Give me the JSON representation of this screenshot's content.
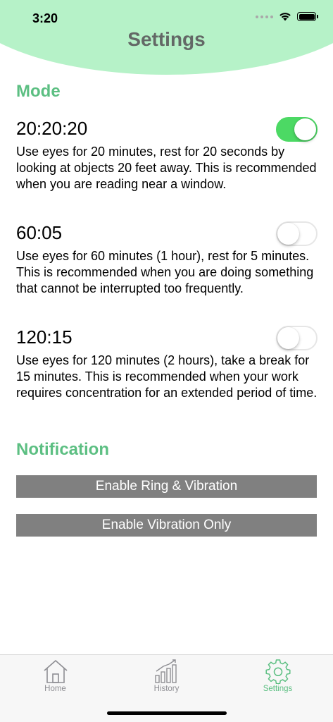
{
  "status_bar": {
    "time": "3:20"
  },
  "header": {
    "title": "Settings"
  },
  "mode_section": {
    "title": "Mode",
    "items": [
      {
        "name": "20:20:20",
        "description": "Use eyes for 20 minutes, rest for 20 seconds by looking at objects 20 feet away. This is recommended when you are reading near a window.",
        "enabled": true
      },
      {
        "name": "60:05",
        "description": "Use eyes for 60 minutes (1 hour), rest for 5 minutes. This is recommended when you are doing something that cannot be interrupted too frequently.",
        "enabled": false
      },
      {
        "name": "120:15",
        "description": "Use eyes for 120 minutes (2 hours), take a break for 15 minutes. This is recommended when your work requires concentration for an extended period of time.",
        "enabled": false
      }
    ]
  },
  "notification_section": {
    "title": "Notification",
    "buttons": [
      {
        "label": "Enable Ring & Vibration"
      },
      {
        "label": "Enable Vibration Only"
      }
    ]
  },
  "tab_bar": {
    "tabs": [
      {
        "label": "Home",
        "icon": "home-icon",
        "active": false
      },
      {
        "label": "History",
        "icon": "history-chart-icon",
        "active": false
      },
      {
        "label": "Settings",
        "icon": "gear-icon",
        "active": true
      }
    ]
  },
  "colors": {
    "header_background": "#b6f2c8",
    "accent_green": "#5cbf82",
    "toggle_on": "#4cd964",
    "button_gray": "#808080",
    "title_gray": "#636866"
  }
}
